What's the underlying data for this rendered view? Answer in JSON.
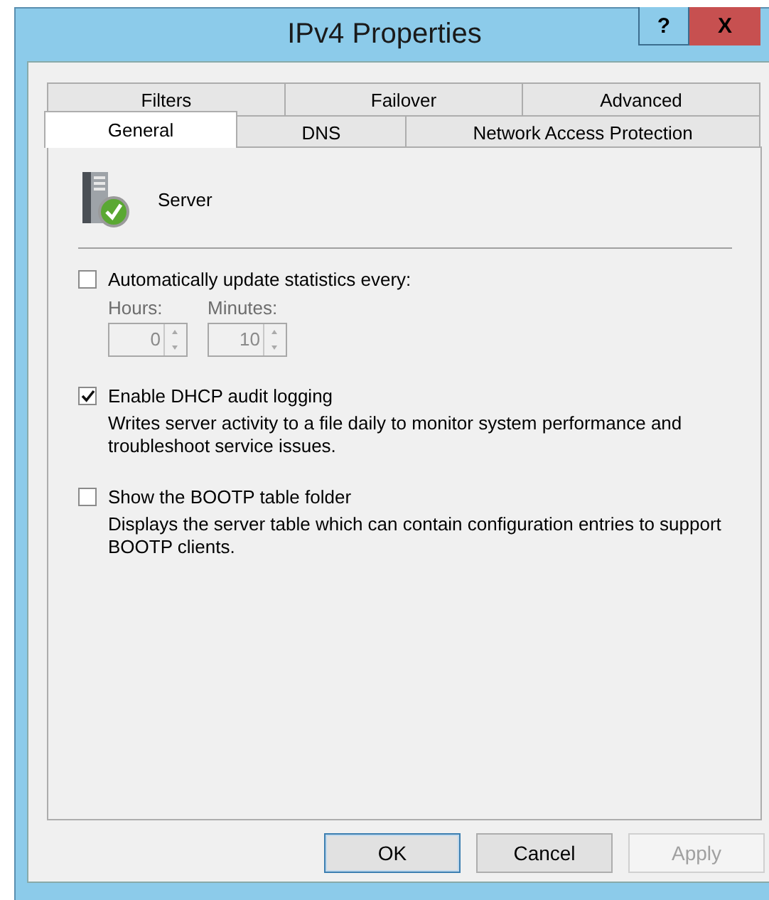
{
  "window": {
    "title": "IPv4 Properties",
    "help": "?",
    "close": "X"
  },
  "tab_rows": [
    [
      {
        "label": "Filters",
        "selected": false
      },
      {
        "label": "Failover",
        "selected": false
      },
      {
        "label": "Advanced",
        "selected": false
      }
    ],
    [
      {
        "label": "General",
        "selected": true
      },
      {
        "label": "DNS",
        "selected": false
      },
      {
        "label": "Network Access Protection",
        "selected": false
      }
    ]
  ],
  "server": {
    "label": "Server"
  },
  "auto_update": {
    "label": "Automatically update statistics every:",
    "checked": false,
    "spinners": [
      {
        "label": "Hours:",
        "value": "0",
        "disabled": true
      },
      {
        "label": "Minutes:",
        "value": "10",
        "disabled": true
      }
    ]
  },
  "options": [
    {
      "label": "Enable DHCP audit logging",
      "checked": true,
      "description": "Writes server activity to a file daily to monitor system performance and troubleshoot service issues."
    },
    {
      "label": "Show the BOOTP table folder",
      "checked": false,
      "description": "Displays the server table which can contain configuration entries to support BOOTP clients."
    }
  ],
  "buttons": [
    {
      "label": "OK",
      "default": true,
      "disabled": false
    },
    {
      "label": "Cancel",
      "default": false,
      "disabled": false
    },
    {
      "label": "Apply",
      "default": false,
      "disabled": true
    }
  ]
}
